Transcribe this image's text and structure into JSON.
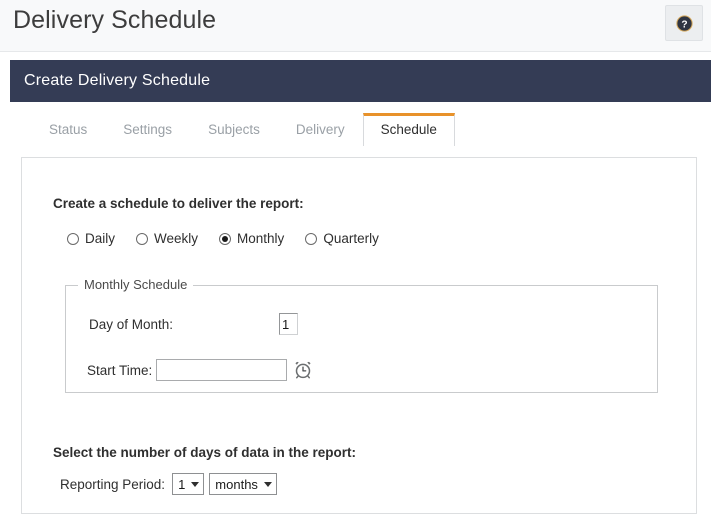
{
  "page": {
    "title": "Delivery Schedule",
    "help_button_label": "?",
    "help_icon": "question-circle-icon"
  },
  "panel": {
    "header_title": "Create Delivery Schedule"
  },
  "tabs": [
    {
      "label": "Status",
      "active": false
    },
    {
      "label": "Settings",
      "active": false
    },
    {
      "label": "Subjects",
      "active": false
    },
    {
      "label": "Delivery",
      "active": false
    },
    {
      "label": "Schedule",
      "active": true
    }
  ],
  "schedule": {
    "heading": "Create a schedule to deliver the report:",
    "frequency_options": [
      {
        "label": "Daily",
        "checked": false
      },
      {
        "label": "Weekly",
        "checked": false
      },
      {
        "label": "Monthly",
        "checked": true
      },
      {
        "label": "Quarterly",
        "checked": false
      }
    ],
    "fieldset": {
      "legend": "Monthly Schedule",
      "day_of_month": {
        "label": "Day of Month:",
        "value": "1"
      },
      "start_time": {
        "label": "Start Time:",
        "value": "",
        "placeholder": "",
        "picker_icon": "alarm-clock-icon"
      }
    }
  },
  "reporting": {
    "heading": "Select the number of days of data in the report:",
    "label": "Reporting Period:",
    "amount_value": "1",
    "unit_value": "months"
  },
  "colors": {
    "navy": "#343c55",
    "accent_orange": "#e8922a",
    "titlebar_bg": "#f8f9fa"
  }
}
